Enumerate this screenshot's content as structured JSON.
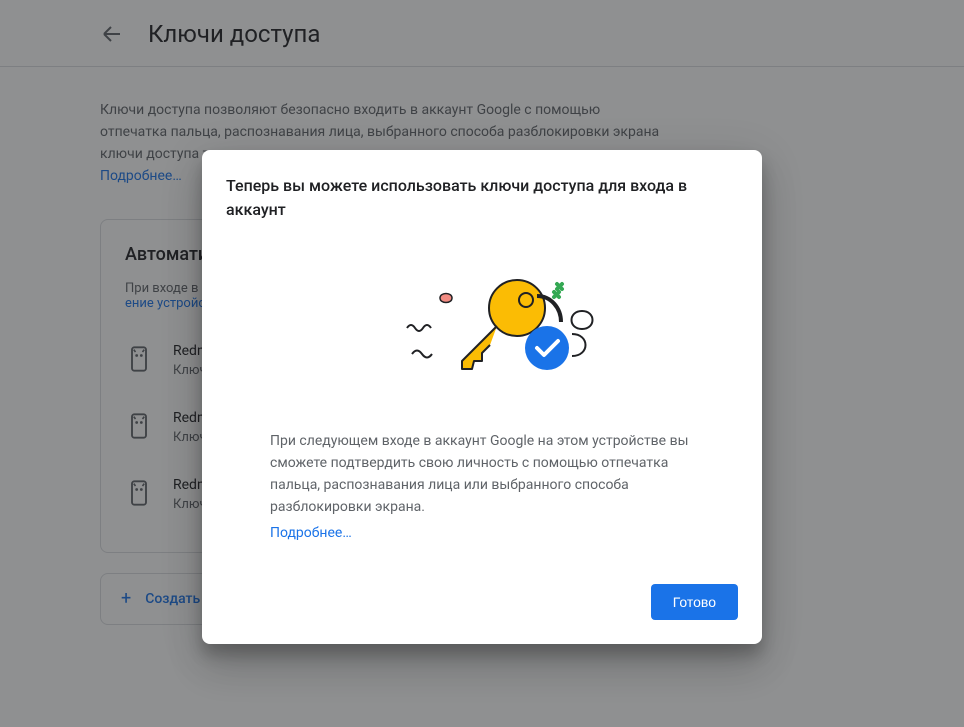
{
  "header": {
    "title": "Ключи доступа"
  },
  "intro": {
    "text": "Ключи доступа позволяют безопасно входить в аккаунт Google с помощью отпечатка пальца, распознавания лица, выбранного способа разблокировки экрана ключи доступа тол",
    "learn_more_label": "Подробнее…"
  },
  "card": {
    "title": "Автоматиче",
    "subtitle": "При входе в акка",
    "manage_label": "ение устройствами"
  },
  "devices": [
    {
      "name": "Redmi",
      "key_label": "Ключ д"
    },
    {
      "name": "Redmi",
      "key_label": "Ключ д"
    },
    {
      "name": "Redmi",
      "key_label": "Ключ д"
    }
  ],
  "create": {
    "label": "Создать ключ"
  },
  "dialog": {
    "title": "Теперь вы можете использовать ключи доступа для входа в аккаунт",
    "body": "При следующем входе в аккаунт Google на этом устройстве вы сможете подтвердить свою личность с помощью отпечатка пальца, распознавания лица или выбранного способа разблокировки экрана.",
    "learn_more_label": "Подробнее…",
    "done_label": "Готово"
  }
}
